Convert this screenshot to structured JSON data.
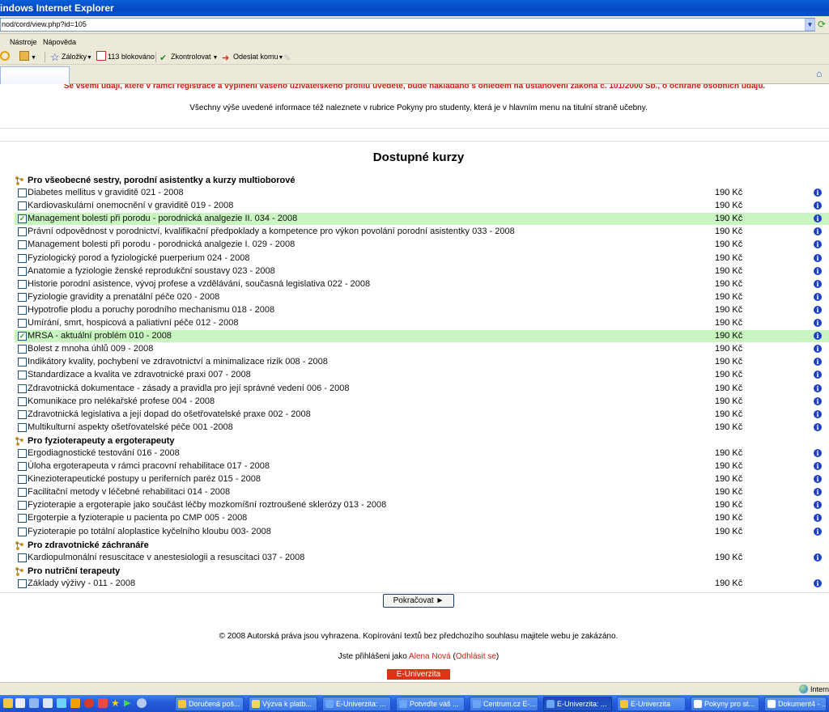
{
  "window": {
    "title": "indows Internet Explorer"
  },
  "address": {
    "url": "nod/cord/view.php?id=105"
  },
  "menu": {
    "items": [
      "Nástroje",
      "Nápověda"
    ]
  },
  "toolbar": {
    "bookmarks_label": "Záložky",
    "blocked_label": "113 blokováno",
    "spellcheck_label": "Zkontrolovat",
    "send_label": "Odeslat komu"
  },
  "page": {
    "warning": "Se všemi údaji, které v rámci registrace a vyplnění vašeho uživatelského profilu uvedete, bude nakládáno s ohledem na ustanovení zákona č. 101/2000 Sb., o ochraně osobních údajů.",
    "info": "Všechny výše uvedené informace též naleznete v rubrice Pokyny pro studenty, která je v hlavním menu na titulní straně učebny.",
    "heading": "Dostupné kurzy",
    "categories": [
      {
        "title": "Pro všeobecné sestry, porodní asistentky a kurzy multioborové",
        "courses": [
          {
            "name": "Diabetes mellitus v graviditě 021 - 2008",
            "price": "190 Kč",
            "checked": false
          },
          {
            "name": "Kardiovaskulární onemocnění v graviditě 019 - 2008",
            "price": "190 Kč",
            "checked": false
          },
          {
            "name": "Management bolesti při porodu - porodnická analgezie II. 034 - 2008",
            "price": "190 Kč",
            "checked": true
          },
          {
            "name": "Právní odpovědnost v porodnictví, kvalifikační předpoklady a kompetence pro výkon povolání porodní asistentky 033 - 2008",
            "price": "190 Kč",
            "checked": false
          },
          {
            "name": "Management bolesti při porodu - porodnická analgezie I. 029 - 2008",
            "price": "190 Kč",
            "checked": false
          },
          {
            "name": "Fyziologický porod a fyziologické puerperium 024 - 2008",
            "price": "190 Kč",
            "checked": false
          },
          {
            "name": "Anatomie a fyziologie ženské reprodukční soustavy 023 - 2008",
            "price": "190 Kč",
            "checked": false
          },
          {
            "name": "Historie porodní asistence, vývoj profese a vzdělávání, současná legislativa 022 - 2008",
            "price": "190 Kč",
            "checked": false
          },
          {
            "name": "Fyziologie gravidity a prenatální péče 020 - 2008",
            "price": "190 Kč",
            "checked": false
          },
          {
            "name": "Hypotrofie plodu a poruchy porodního mechanismu 018 - 2008",
            "price": "190 Kč",
            "checked": false
          },
          {
            "name": "Umírání, smrt, hospicová a paliativní péče 012 - 2008",
            "price": "190 Kč",
            "checked": false
          },
          {
            "name": "MRSA - aktuální problém 010 - 2008",
            "price": "190 Kč",
            "checked": true
          },
          {
            "name": "Bolest z mnoha úhlů 009 - 2008",
            "price": "190 Kč",
            "checked": false
          },
          {
            "name": "Indikátory kvality, pochybení ve zdravotnictví a minimalizace rizik 008 - 2008",
            "price": "190 Kč",
            "checked": false
          },
          {
            "name": "Standardizace a kvalita ve zdravotnické praxi 007 - 2008",
            "price": "190 Kč",
            "checked": false
          },
          {
            "name": "Zdravotnická dokumentace - zásady a pravidla pro její správné vedení 006 - 2008",
            "price": "190 Kč",
            "checked": false
          },
          {
            "name": "Komunikace pro nelékařské profese 004 - 2008",
            "price": "190 Kč",
            "checked": false
          },
          {
            "name": "Zdravotnická legislativa a její dopad do ošetřovatelské praxe 002 - 2008",
            "price": "190 Kč",
            "checked": false
          },
          {
            "name": "Multikulturní aspekty ošetřovatelské péče 001 -2008",
            "price": "190 Kč",
            "checked": false
          }
        ]
      },
      {
        "title": "Pro fyzioterapeuty a ergoterapeuty",
        "courses": [
          {
            "name": "Ergodiagnostické testování 016 - 2008",
            "price": "190 Kč",
            "checked": false
          },
          {
            "name": "Úloha ergoterapeuta v rámci pracovní rehabilitace 017 - 2008",
            "price": "190 Kč",
            "checked": false
          },
          {
            "name": "Kinezioterapeutické postupy u periferních paréz 015 - 2008",
            "price": "190 Kč",
            "checked": false
          },
          {
            "name": "Facilitační metody v léčebné rehabilitaci 014 - 2008",
            "price": "190 Kč",
            "checked": false
          },
          {
            "name": "Fyzioterapie a ergoterapie jako součást léčby mozkomíšní roztroušené sklerózy 013 - 2008",
            "price": "190 Kč",
            "checked": false
          },
          {
            "name": "Ergoterpie a fyzioterapie u pacienta po CMP 005 - 2008",
            "price": "190 Kč",
            "checked": false
          },
          {
            "name": "Fyzioterapie po totální aloplastice kyčelního kloubu 003- 2008",
            "price": "190 Kč",
            "checked": false
          }
        ]
      },
      {
        "title": "Pro zdravotnické záchranáře",
        "courses": [
          {
            "name": "Kardiopulmonální resuscitace v anestesiologii a resuscitaci 037 - 2008",
            "price": "190 Kč",
            "checked": false
          }
        ]
      },
      {
        "title": "Pro nutriční terapeuty",
        "courses": [
          {
            "name": "Základy výživy - 011 - 2008",
            "price": "190 Kč",
            "checked": false
          }
        ]
      }
    ],
    "continue_label": "Pokračovat ►",
    "copyright": "© 2008 Autorská práva jsou vyhrazena. Kopírování textů bez předchozího souhlasu majitele webu je zakázáno.",
    "login_prefix": "Jste přihlášeni jako ",
    "login_user": "Alena Nová",
    "login_logout": "Odhlásit se",
    "brand": "E-Univerzita"
  },
  "statusbar": {
    "zone": "Intern"
  },
  "taskbar": {
    "tasks": [
      {
        "label": "Doručená poš...",
        "icon_color": "#f6c342",
        "active": false
      },
      {
        "label": "Výzva k platb...",
        "icon_color": "#f2d46a",
        "active": false
      },
      {
        "label": "E-Univerzita: ...",
        "icon_color": "#6aa5f5",
        "active": false
      },
      {
        "label": "Potvrďte váš ...",
        "icon_color": "#6aa5f5",
        "active": false
      },
      {
        "label": "Centrum.cz E-...",
        "icon_color": "#6aa5f5",
        "active": false
      },
      {
        "label": "E-Univerzita: ...",
        "icon_color": "#6aa5f5",
        "active": true
      },
      {
        "label": "E-Univerzita",
        "icon_color": "#f6c342",
        "active": false
      },
      {
        "label": "Pokyny pro st...",
        "icon_color": "#ffffff",
        "active": false
      },
      {
        "label": "Dokument4 - ...",
        "icon_color": "#ffffff",
        "active": false
      }
    ]
  }
}
